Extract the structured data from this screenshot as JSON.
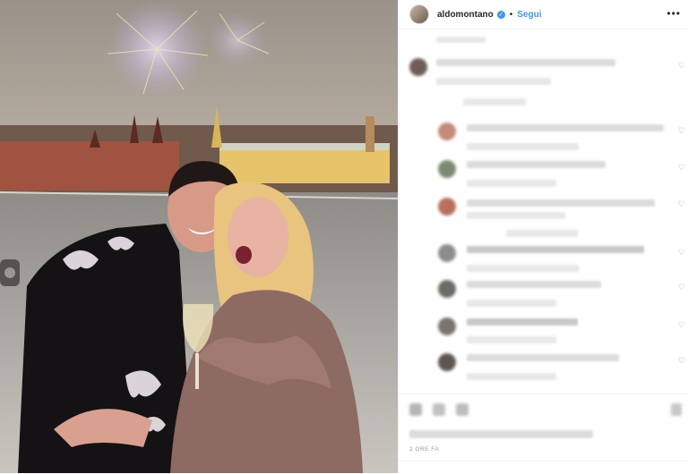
{
  "post": {
    "username": "aldomontano",
    "verified_symbol": "✓",
    "separator": "•",
    "follow_label": "Segui",
    "more_icon": "•••",
    "timestamp": "2 ORE FA",
    "heart_icon": "♡"
  },
  "colors": {
    "follow_blue": "#3897f0",
    "text_dark": "#262626",
    "border": "#efefef"
  }
}
